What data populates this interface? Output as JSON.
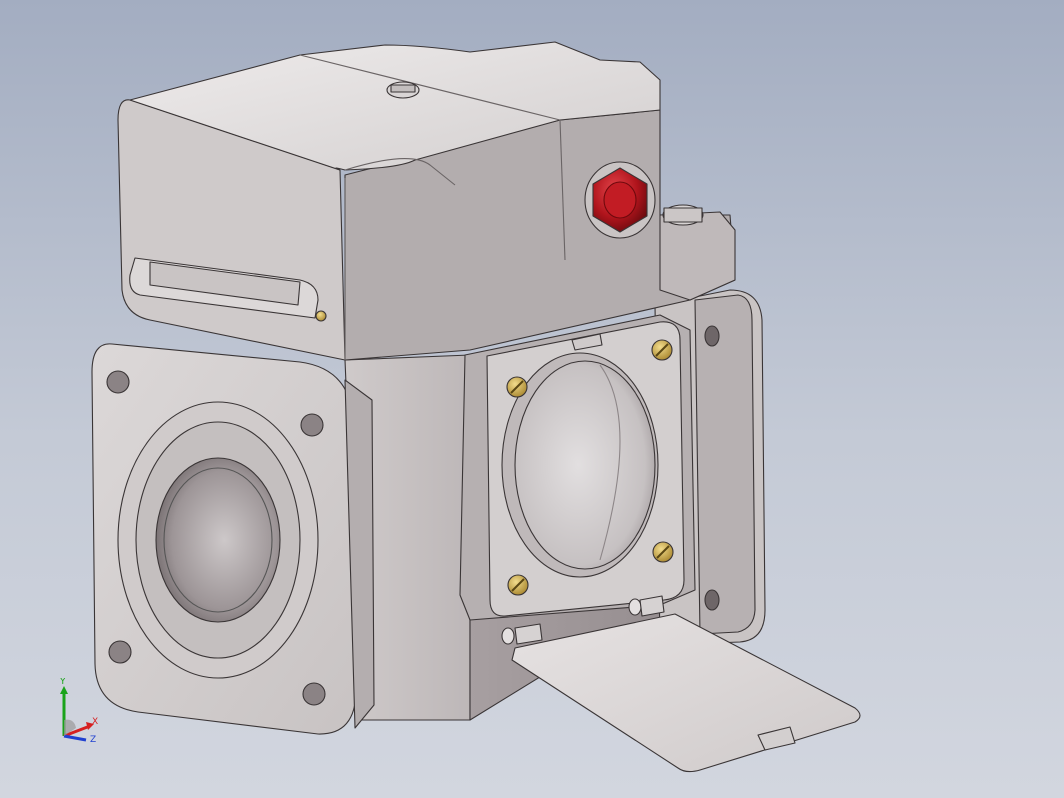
{
  "viewport": {
    "background_top": "#a3adc1",
    "background_bottom": "#d2d6df"
  },
  "model": {
    "body_color": "#d8d4d4",
    "shadow_color": "#a9a3a5",
    "highlight_color": "#efecec",
    "indicator_color": "#b0141c",
    "screw_color": "#c8a64a",
    "icon": "cad-part-icon"
  },
  "triad": {
    "x_label": "X",
    "y_label": "Y",
    "z_label": "Z",
    "x_color": "#d62020",
    "y_color": "#1aa31a",
    "z_color": "#2040d0"
  }
}
